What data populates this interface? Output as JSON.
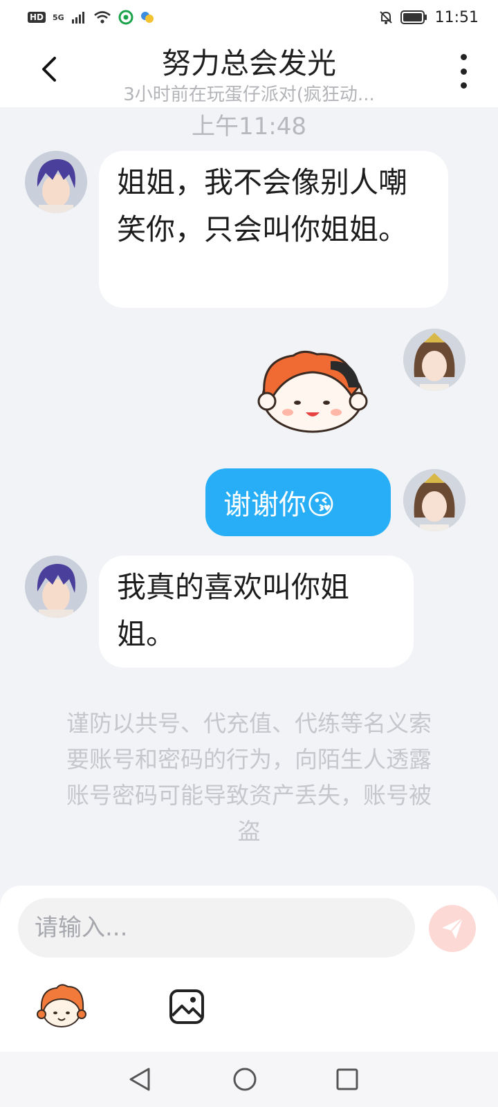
{
  "status_bar": {
    "hd": "HD",
    "net": "5G",
    "time": "11:51",
    "icons": [
      "signal-icon",
      "wifi-icon",
      "app-notification-icon",
      "bell-muted-icon",
      "battery-icon"
    ]
  },
  "header": {
    "title": "努力总会发光",
    "subtitle": "3小时前在玩蛋仔派对(疯狂动..."
  },
  "chat": {
    "timestamp": "上午11:48",
    "messages": [
      {
        "side": "left",
        "text": "姐姐，我不会像别人嘲笑你，只会叫你姐姐。"
      },
      {
        "side": "right",
        "type": "sticker",
        "sticker": "eggy-character-sticker"
      },
      {
        "side": "right",
        "text": "谢谢你😘"
      },
      {
        "side": "left",
        "text": "我真的喜欢叫你姐姐。"
      }
    ],
    "notice": "谨防以共号、代充值、代练等名义索要账号和密码的行为，向陌生人透露账号密码可能导致资产丢失，账号被盗"
  },
  "input": {
    "placeholder": "请输入..."
  },
  "colors": {
    "accent_bubble": "#27aef7",
    "background": "#f1f3f6",
    "send_button": "#fcd9d5"
  }
}
